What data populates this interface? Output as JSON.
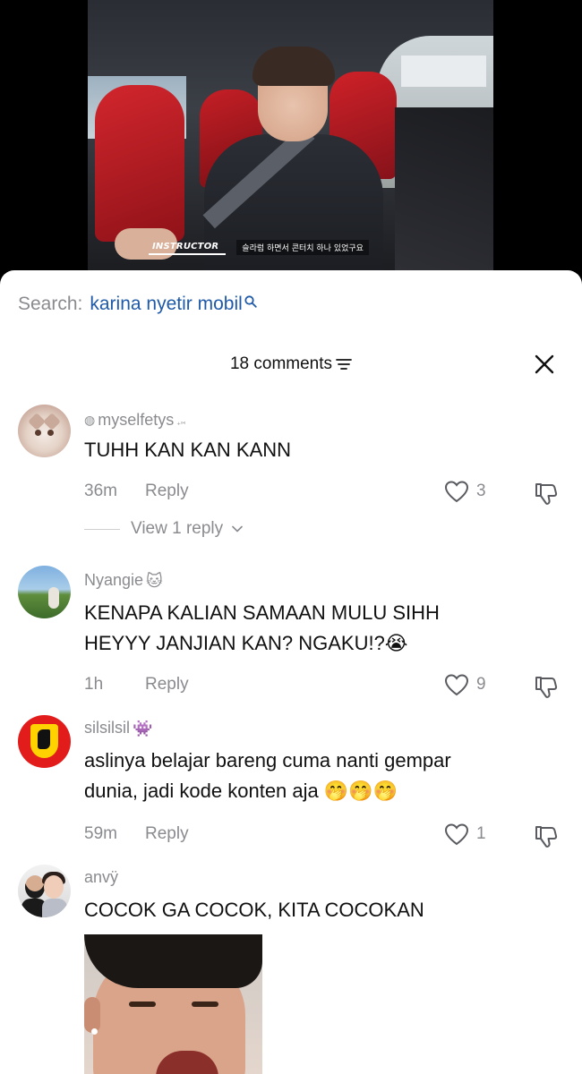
{
  "video": {
    "overlay_tag": "INSTRUCTOR",
    "subtitle": "슬라럼 하면서 콘터치 하나 있었구요"
  },
  "search": {
    "label": "Search:",
    "term": "karina nyetir mobil"
  },
  "header": {
    "comments_count": "18 comments"
  },
  "comments": [
    {
      "username": "myselfetys",
      "username_prefix": "◍",
      "username_suffix": "₊⑅",
      "text": "TUHH KAN KAN KANN",
      "time": "36m",
      "reply_label": "Reply",
      "likes": "3",
      "view_replies": "View 1 reply"
    },
    {
      "username": "Nyangie",
      "username_emoji": "🐱",
      "text_line1": "KENAPA KALIAN SAMAAN MULU SIHH",
      "text_line2": "HEYYY JANJIAN KAN? NGAKU!?😭",
      "time": "1h",
      "reply_label": "Reply",
      "likes": "9"
    },
    {
      "username": "silsilsil",
      "username_emoji": "👾",
      "text_line1": "aslinya belajar bareng cuma nanti gempar",
      "text_line2": "dunia, jadi kode konten aja 🤭🤭🤭",
      "time": "59m",
      "reply_label": "Reply",
      "likes": "1"
    },
    {
      "username": "anvÿ",
      "text": "COCOK GA COCOK, KITA COCOKAN"
    }
  ],
  "icons": {
    "search": "search-icon",
    "filter": "filter-icon",
    "close": "close-icon",
    "heart": "heart-icon",
    "dislike": "dislike-icon",
    "chevron": "chevron-down-icon"
  },
  "colors": {
    "search_term": "#1f5aa8",
    "muted_text": "#8a8b8f",
    "primary_text": "#111111"
  }
}
